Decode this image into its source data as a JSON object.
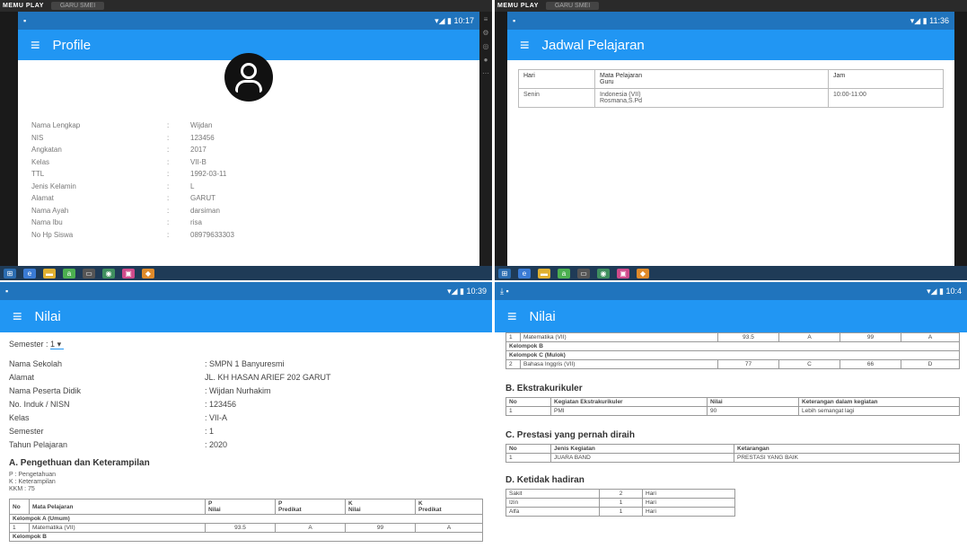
{
  "emulator": {
    "brand": "MEMU PLAY",
    "tab_label": "GARU SMEI"
  },
  "profile": {
    "status_time": "10:17",
    "title": "Profile",
    "rows": [
      {
        "label": "Nama Lengkap",
        "sep": ":",
        "value": "Wijdan"
      },
      {
        "label": "NIS",
        "sep": ":",
        "value": "123456"
      },
      {
        "label": "Angkatan",
        "sep": ":",
        "value": "2017"
      },
      {
        "label": "Kelas",
        "sep": ":",
        "value": "VII-B"
      },
      {
        "label": "TTL",
        "sep": ":",
        "value": "1992-03-11"
      },
      {
        "label": "Jenis Kelamin",
        "sep": ":",
        "value": "L"
      },
      {
        "label": "Alamat",
        "sep": ":",
        "value": "GARUT"
      },
      {
        "label": "Nama Ayah",
        "sep": ":",
        "value": "darsiman"
      },
      {
        "label": "Nama Ibu",
        "sep": ":",
        "value": "risa"
      },
      {
        "label": "No Hp Siswa",
        "sep": ":",
        "value": "08979633303"
      }
    ]
  },
  "jadwal": {
    "status_time": "11:36",
    "title": "Jadwal Pelajaran",
    "headers": {
      "hari": "Hari",
      "mapel": "Mata Pelajaran",
      "guru": "Guru",
      "jam": "Jam"
    },
    "rows": [
      {
        "hari": "Senin",
        "mapel": "Indonesia (VII)",
        "guru": "Rosmana,S.Pd",
        "jam": "10:00-11:00"
      }
    ]
  },
  "nilai1": {
    "status_time": "10:39",
    "title": "Nilai",
    "semester_label": "Semester :",
    "semester_value": "1",
    "info": [
      {
        "label": "Nama Sekolah",
        "value": ": SMPN 1 Banyuresmi"
      },
      {
        "label": "Alamat",
        "value": "JL. KH HASAN ARIEF 202 GARUT"
      },
      {
        "label": "Nama Peserta Didik",
        "value": ": Wijdan Nurhakim"
      },
      {
        "label": "No. Induk / NISN",
        "value": ": 123456"
      },
      {
        "label": "Kelas",
        "value": ": VII-A"
      },
      {
        "label": "Semester",
        "value": ": 1"
      },
      {
        "label": "Tahun Pelajaran",
        "value": ": 2020"
      }
    ],
    "section_a": "A. Pengethuan dan Keterampilan",
    "legend": [
      "P : Pengetahuan",
      "K : Keterampilan",
      "KKM : 75"
    ],
    "headers": {
      "no": "No",
      "mapel": "Mata Pelajaran",
      "p": "P",
      "nilai": "Nilai",
      "predikat": "Predikat",
      "k": "K"
    },
    "group_a": "Kelompok A (Umum)",
    "row1": {
      "no": "1",
      "mapel": "Matematika (VII)",
      "pn": "93.5",
      "pp": "A",
      "kn": "99",
      "kp": "A"
    },
    "group_b": "Kelompok B"
  },
  "nilai2": {
    "status_time": "10:4",
    "title": "Nilai",
    "row1": {
      "no": "1",
      "mapel": "Matematika (VII)",
      "pn": "93.5",
      "pp": "A",
      "kn": "99",
      "kp": "A"
    },
    "group_b": "Kelompok B",
    "group_c": "Kelompok C (Mulok)",
    "row2": {
      "no": "2",
      "mapel": "Bahasa Inggris (VII)",
      "pn": "77",
      "pp": "C",
      "kn": "66",
      "kp": "D"
    },
    "section_b": "B. Ekstrakurikuler",
    "ekstra_headers": {
      "no": "No",
      "kegiatan": "Kegiatan Ekstrakurikuler",
      "nilai": "Nilai",
      "ket": "Keterangan dalam kegiatan"
    },
    "ekstra_row": {
      "no": "1",
      "kegiatan": "PMI",
      "nilai": "90",
      "ket": "Lebih semangat lagi"
    },
    "section_c": "C. Prestasi yang pernah diraih",
    "prestasi_headers": {
      "no": "No",
      "jenis": "Jenis Kegiatan",
      "ket": "Ketarangan"
    },
    "prestasi_row": {
      "no": "1",
      "jenis": "JUARA BAND",
      "ket": "PRESTASI YANG BAIK"
    },
    "section_d": "D. Ketidak hadiran",
    "absen": [
      {
        "label": "Sakit",
        "count": "2",
        "unit": "Hari"
      },
      {
        "label": "Izin",
        "count": "1",
        "unit": "Hari"
      },
      {
        "label": "Alfa",
        "count": "1",
        "unit": "Hari"
      }
    ]
  }
}
